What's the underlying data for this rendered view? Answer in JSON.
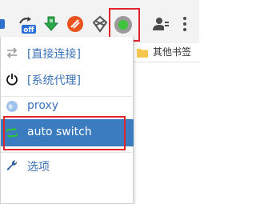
{
  "toolbar": {
    "extensions": [
      {
        "icon": "extension-partial-icon"
      },
      {
        "icon": "off-badge-icon",
        "badge": "off"
      },
      {
        "icon": "green-download-arrow-icon"
      },
      {
        "icon": "orange-extension-icon"
      },
      {
        "icon": "knot-icon"
      },
      {
        "icon": "proxy-switch-icon"
      }
    ],
    "account_icon": "account-manage-icon",
    "menu_icon": "kebab-menu-icon"
  },
  "bookmarks": {
    "other_bookmarks": "其他书签"
  },
  "popup": {
    "items": [
      {
        "label": "[直接连接]",
        "icon": "direct-arrows-icon"
      },
      {
        "label": "[系统代理]",
        "icon": "power-icon"
      },
      {
        "label": "proxy",
        "icon": "globe-icon"
      },
      {
        "label": "auto switch",
        "icon": "auto-switch-icon",
        "selected": true
      },
      {
        "label": "选项",
        "icon": "wrench-icon"
      }
    ]
  },
  "colors": {
    "selected_bg": "#3b7bbf",
    "link_blue": "#3b73b9",
    "annotation_red": "#e0242b",
    "toolbar_bg": "#f3f3f3"
  }
}
